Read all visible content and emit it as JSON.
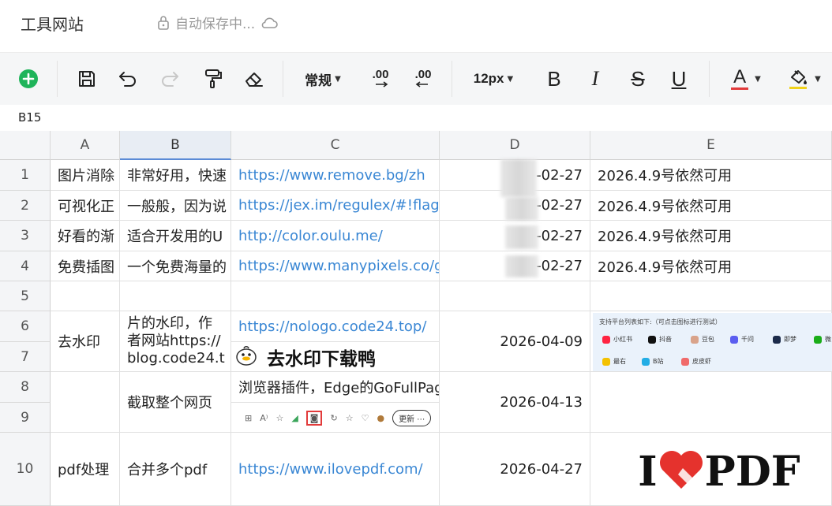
{
  "title_bar": {
    "doc_title": "工具网站",
    "save_status": "自动保存中..."
  },
  "toolbar": {
    "number_format": "常规",
    "increase_decimal": ".00",
    "decrease_decimal": ".00",
    "font_size": "12px",
    "bold": "B",
    "italic": "I",
    "strike": "S",
    "underline": "U",
    "font_color_letter": "A",
    "colors": {
      "font_color": "#e23b3b",
      "fill_color": "#f1d21a",
      "add": "#1fb45a"
    }
  },
  "name_box": "B15",
  "columns": [
    "A",
    "B",
    "C",
    "D",
    "E"
  ],
  "selected_column": "B",
  "rows": [
    {
      "num": "1",
      "a": "图片消除",
      "b": "非常好用，快速",
      "c": "https://www.remove.bg/zh",
      "d": "-02-27",
      "e": "2026.4.9号依然可用"
    },
    {
      "num": "2",
      "a": "可视化正",
      "b": "一般般，因为说",
      "c": "https://jex.im/regulex/#!flags=",
      "d": "-02-27",
      "e": "2026.4.9号依然可用"
    },
    {
      "num": "3",
      "a": "好看的渐",
      "b": "适合开发用的U",
      "c": "http://color.oulu.me/",
      "d": "-02-27",
      "e": "2026.4.9号依然可用"
    },
    {
      "num": "4",
      "a": "免费插图",
      "b": "一个免费海量的",
      "c": "https://www.manypixels.co/ga",
      "d": "-02-27",
      "e": "2026.4.9号依然可用"
    },
    {
      "num": "5",
      "a": "",
      "b": "",
      "c": "",
      "d": "",
      "e": ""
    }
  ],
  "merged": {
    "r6_7": {
      "a": "去水印",
      "b": "片的水印，作者网站https://blog.code24.t",
      "c": "https://nologo.code24.top/",
      "c_banner": "去水印下载鸭",
      "d": "2026-04-09",
      "platform_title": "支持平台列表如下:（可点击图标进行测试）",
      "platforms": [
        "小红书",
        "抖音",
        "豆包",
        "千问",
        "即梦",
        "微",
        "最右",
        "B站",
        "皮皮虾"
      ]
    },
    "r8_9": {
      "b": "截取整个网页",
      "c": "浏览器插件，Edge的GoFullPag",
      "d": "2026-04-13",
      "browser_update": "更新"
    },
    "r10": {
      "a": "pdf处理",
      "b": "合并多个pdf",
      "c": "https://www.ilovepdf.com/",
      "d": "2026-04-27",
      "logo": "I PDF"
    }
  },
  "row_numbers_lower": [
    "6",
    "7",
    "8",
    "9",
    "10"
  ]
}
